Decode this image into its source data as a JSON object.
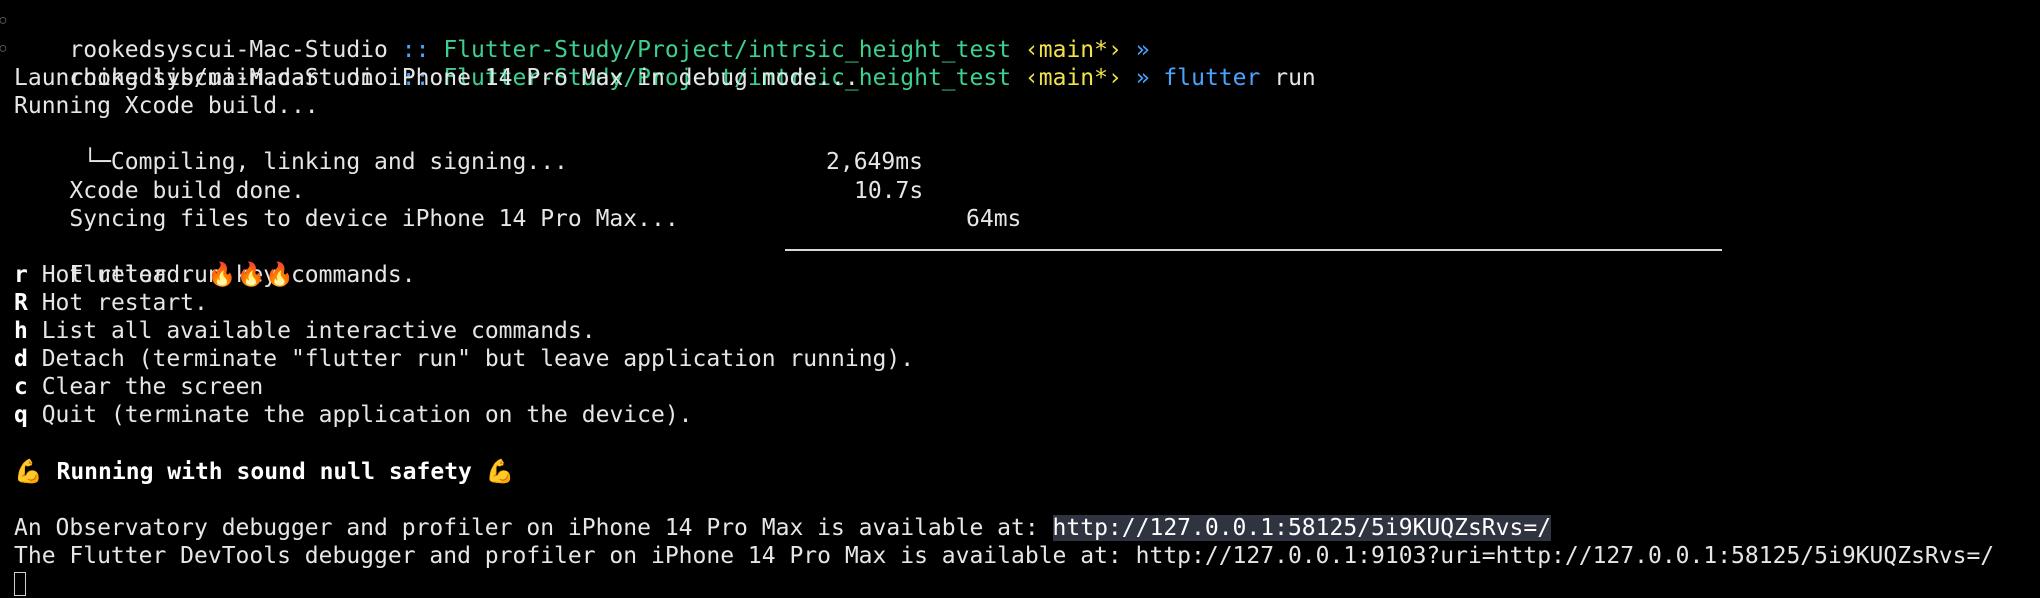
{
  "prompt": {
    "host": "rookedsyscui-Mac-Studio",
    "sep": "::",
    "path": "Flutter-Study/Project/intrsic_height_test",
    "branch": "‹main*›",
    "arrow": "»"
  },
  "command": {
    "name": "flutter",
    "args": "run"
  },
  "output": {
    "launching": "Launching lib/main.dart on iPhone 14 Pro Max in debug mode...",
    "running_xcode": "Running Xcode build...",
    "compiling_label": " └─Compiling, linking and signing...",
    "compiling_time": "2,649ms",
    "xcode_done_label": "Xcode build done.",
    "xcode_done_time": "10.7s",
    "syncing_label": "Syncing files to device iPhone 14 Pro Max...",
    "syncing_time": "64ms",
    "key_commands_title": "Flutter run key commands."
  },
  "key_commands": [
    {
      "key": "r",
      "desc": " Hot reload. 🔥🔥🔥"
    },
    {
      "key": "R",
      "desc": " Hot restart."
    },
    {
      "key": "h",
      "desc": " List all available interactive commands."
    },
    {
      "key": "d",
      "desc": " Detach (terminate \"flutter run\" but leave application running)."
    },
    {
      "key": "c",
      "desc": " Clear the screen"
    },
    {
      "key": "q",
      "desc": " Quit (terminate the application on the device)."
    }
  ],
  "null_safety": "💪 Running with sound null safety 💪",
  "observatory": {
    "prefix": "An Observatory debugger and profiler on iPhone 14 Pro Max is available at: ",
    "url": "http://127.0.0.1:58125/5i9KUQZsRvs=/"
  },
  "devtools": {
    "prefix": "The Flutter DevTools debugger and profiler on iPhone 14 Pro Max is available at: ",
    "url": "http://127.0.0.1:9103?uri=http://127.0.0.1:58125/5i9KUQZsRvs=/"
  }
}
